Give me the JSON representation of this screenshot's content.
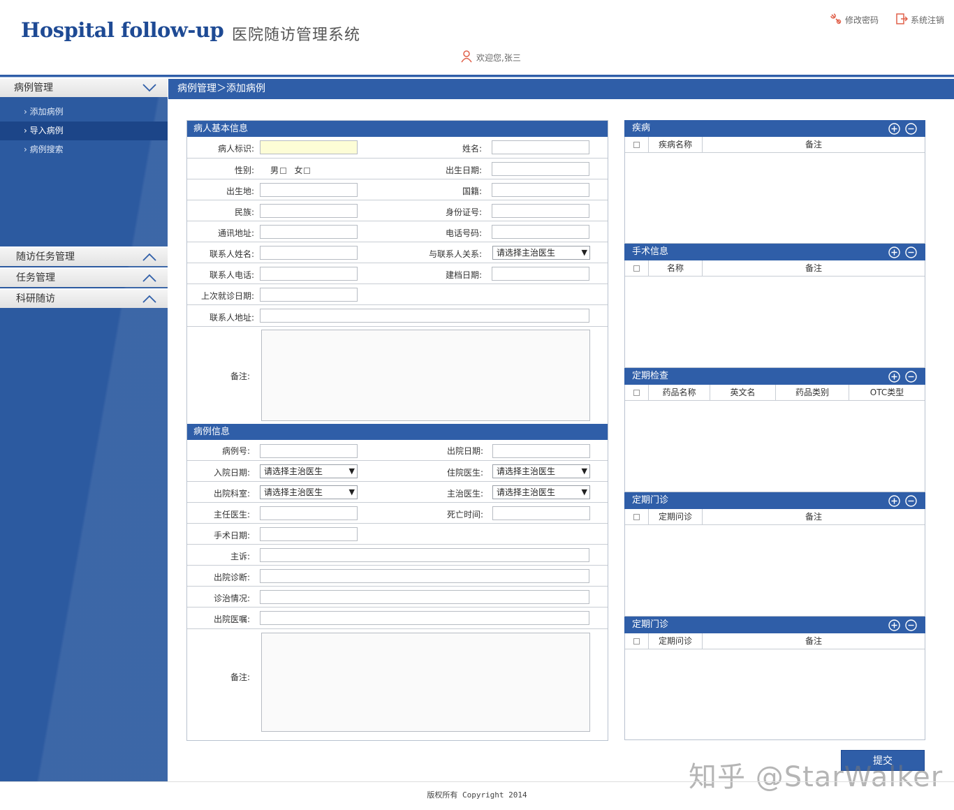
{
  "header": {
    "logo_en": "Hospital follow-up",
    "logo_cn": "医院随访管理系统",
    "change_password": "修改密码",
    "logout": "系统注销",
    "welcome": "欢迎您,张三"
  },
  "sidebar": {
    "groups": [
      {
        "label": "病例管理",
        "expanded": true,
        "items": [
          "添加病例",
          "导入病例",
          "病例搜索"
        ],
        "active_item": "导入病例"
      },
      {
        "label": "随访任务管理",
        "expanded": false
      },
      {
        "label": "任务管理",
        "expanded": false
      },
      {
        "label": "科研随访",
        "expanded": false
      }
    ]
  },
  "breadcrumb": "病例管理＞添加病例",
  "basic_info": {
    "title": "病人基本信息",
    "patient_id": "病人标识:",
    "name": "姓名:",
    "gender": "性别:",
    "male": "男",
    "female": "女",
    "birth_date": "出生日期:",
    "birthplace": "出生地:",
    "nationality": "国籍:",
    "ethnicity": "民族:",
    "id_number": "身份证号:",
    "address": "通讯地址:",
    "phone": "电话号码:",
    "contact_name": "联系人姓名:",
    "contact_relation": "与联系人关系:",
    "contact_relation_value": "请选择主治医生",
    "contact_phone": "联系人电话:",
    "file_date": "建档日期:",
    "last_visit": "上次就诊日期:",
    "contact_address": "联系人地址:",
    "remark": "备注:"
  },
  "case_info": {
    "title": "病例信息",
    "case_no": "病例号:",
    "discharge_date": "出院日期:",
    "admit_date": "入院日期:",
    "admit_date_value": "请选择主治医生",
    "resident_doctor": "住院医生:",
    "resident_doctor_value": "请选择主治医生",
    "discharge_dept": "出院科室:",
    "discharge_dept_value": "请选择主治医生",
    "attending": "主治医生:",
    "attending_value": "请选择主治医生",
    "director": "主任医生:",
    "death_time": "死亡时间:",
    "surgery_date": "手术日期:",
    "complaint": "主诉:",
    "discharge_diag": "出院诊断:",
    "treatment": "诊治情况:",
    "discharge_advice": "出院医嘱:",
    "remark": "备注:"
  },
  "right_panels": [
    {
      "title": "疾病",
      "columns": [
        "疾病名称",
        "备注"
      ]
    },
    {
      "title": "手术信息",
      "columns": [
        "名称",
        "备注"
      ]
    },
    {
      "title": "定期检查",
      "columns": [
        "药品名称",
        "英文名",
        "药品类别",
        "OTC类型"
      ]
    },
    {
      "title": "定期门诊",
      "columns": [
        "定期问诊",
        "备注"
      ]
    },
    {
      "title": "定期门诊",
      "columns": [
        "定期问诊",
        "备注"
      ]
    }
  ],
  "submit": "提交",
  "watermark": "知乎 @StarWalker",
  "footer": "版权所有 Copyright 2014",
  "colors": {
    "primary": "#2f5ea8",
    "sidebar": "#2c5aa0",
    "logo": "#1e4a94",
    "icon": "#e0604a"
  }
}
